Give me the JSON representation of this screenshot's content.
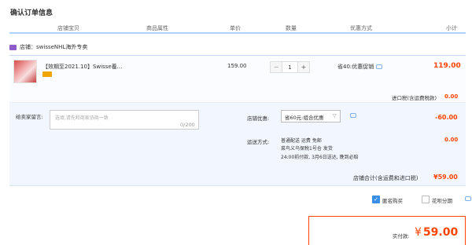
{
  "page_title": "确认订单信息",
  "columns": [
    "店铺宝贝",
    "商品属性",
    "单价",
    "数量",
    "优惠方式",
    "小计"
  ],
  "shop": {
    "label": "店铺：swisseNHL海外专卖"
  },
  "item": {
    "name": "【效期至2021.10】Swisse養...",
    "price": "159.00",
    "quantity": "1",
    "minus": "−",
    "plus": "+",
    "promo": "省40:优惠促销",
    "subtotal": "119.00"
  },
  "import_tax": {
    "label": "进口税(含运费税款)",
    "value": "0.00"
  },
  "message": {
    "label": "给卖家留言:",
    "placeholder": "选填,请先和商家协商一致",
    "count": "0/200"
  },
  "coupon": {
    "label": "店铺优惠:",
    "selected": "省60元:组合优惠",
    "value": "-60.00"
  },
  "shipping": {
    "label": "运送方式:",
    "line1": "普通配送 运费 免邮",
    "line2": "菜鸟义乌保税1号仓  发货",
    "line3": "24:00前付款, 3月6日送达, 晚到必赔",
    "value": "0.00"
  },
  "shop_total": {
    "label": "店铺合计(含运费和进口税)",
    "value": "¥59.00"
  },
  "options": {
    "anonymous": "匿名购买",
    "huabei": "花呗分期"
  },
  "payment": {
    "label": "实付款:",
    "currency": "¥",
    "value": "59.00"
  }
}
